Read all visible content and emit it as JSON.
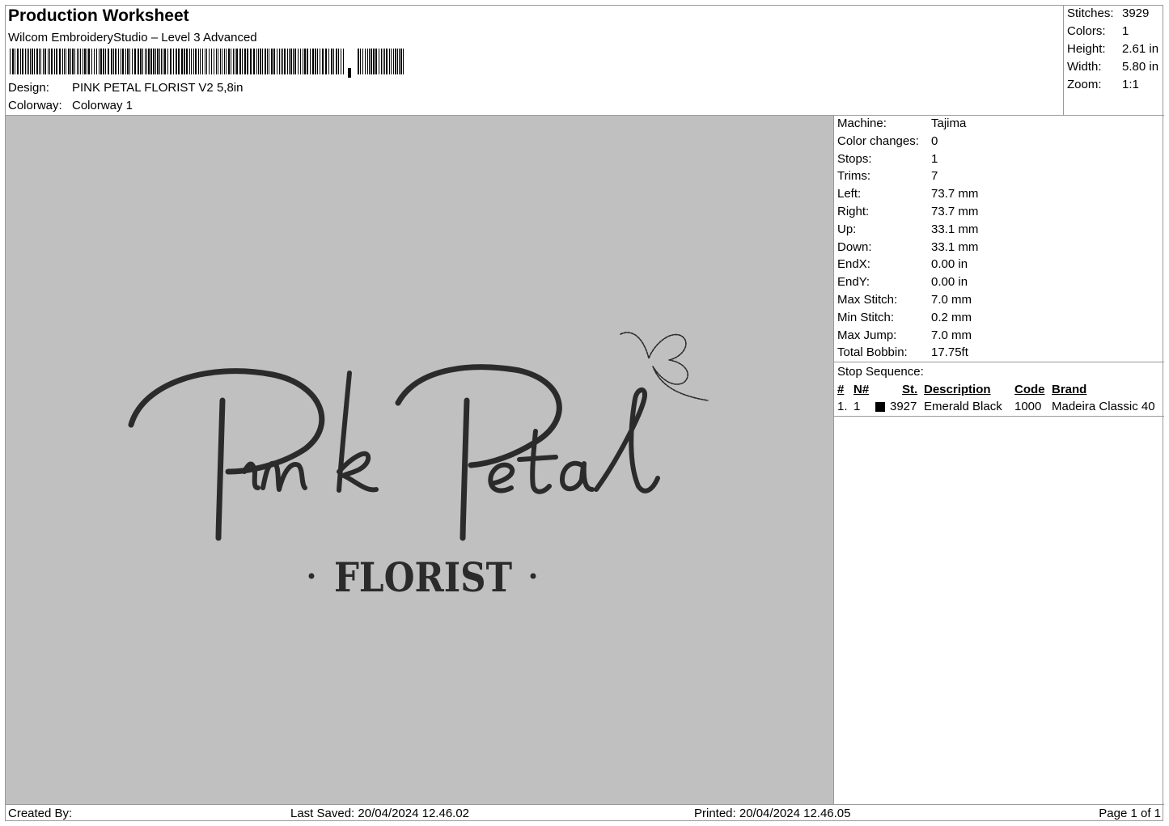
{
  "header": {
    "title": "Production Worksheet",
    "software": "Wilcom EmbroideryStudio – Level 3 Advanced",
    "design_label": "Design:",
    "design_value": "PINK PETAL FLORIST V2 5,8in",
    "colorway_label": "Colorway:",
    "colorway_value": "Colorway 1"
  },
  "summary": [
    {
      "label": "Stitches:",
      "value": "3929"
    },
    {
      "label": "Colors:",
      "value": "1"
    },
    {
      "label": "Height:",
      "value": "2.61 in"
    },
    {
      "label": "Width:",
      "value": "5.80 in"
    },
    {
      "label": "Zoom:",
      "value": "1:1"
    }
  ],
  "machine_info": [
    {
      "label": "Machine:",
      "value": "Tajima"
    },
    {
      "label": "Color changes:",
      "value": "0"
    },
    {
      "label": "Stops:",
      "value": "1"
    },
    {
      "label": "Trims:",
      "value": "7"
    },
    {
      "label": "Left:",
      "value": "73.7 mm"
    },
    {
      "label": "Right:",
      "value": "73.7 mm"
    },
    {
      "label": "Up:",
      "value": "33.1 mm"
    },
    {
      "label": "Down:",
      "value": "33.1 mm"
    },
    {
      "label": "EndX:",
      "value": "0.00 in"
    },
    {
      "label": "EndY:",
      "value": "0.00 in"
    },
    {
      "label": "Max Stitch:",
      "value": "7.0 mm"
    },
    {
      "label": "Min Stitch:",
      "value": "0.2 mm"
    },
    {
      "label": "Max Jump:",
      "value": "7.0 mm"
    },
    {
      "label": "Total Bobbin:",
      "value": "17.75ft"
    }
  ],
  "stop_sequence": {
    "title": "Stop Sequence:",
    "headers": {
      "num": "#",
      "needle": "N#",
      "stitches": "St.",
      "description": "Description",
      "code": "Code",
      "brand": "Brand"
    },
    "rows": [
      {
        "num": "1.",
        "needle": "1",
        "swatch_color": "#000000",
        "stitches": "3927",
        "description": "Emerald Black",
        "code": "1000",
        "brand": "Madeira Classic 40"
      }
    ]
  },
  "design": {
    "script_text": "Pink Petal",
    "sub_text": "FLORIST",
    "thread_color": "#2b2b2b",
    "background_color": "#c0c0c0"
  },
  "footer": {
    "created_by": "Created By:",
    "last_saved": "Last Saved: 20/04/2024 12.46.02",
    "printed": "Printed: 20/04/2024 12.46.05",
    "page": "Page 1 of 1"
  }
}
